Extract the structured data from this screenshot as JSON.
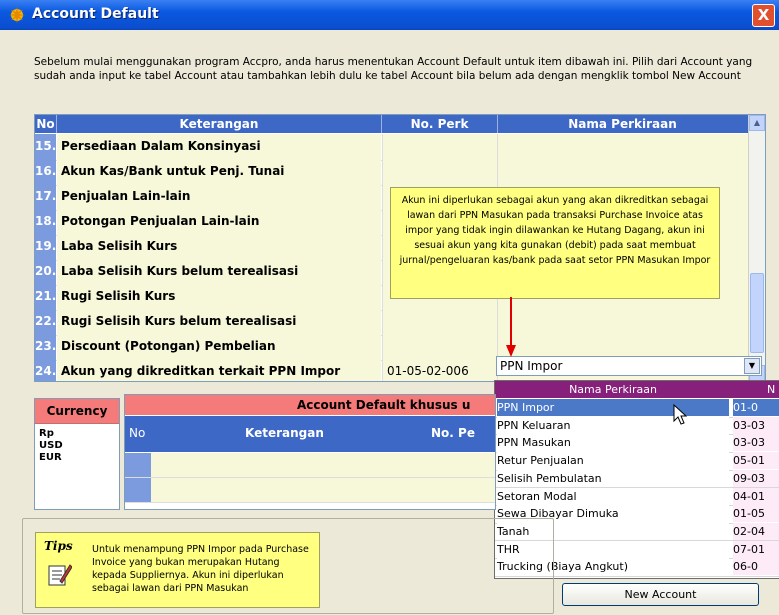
{
  "window": {
    "title": "Account Default",
    "close_label": "X"
  },
  "intro_text": "Sebelum mulai menggunakan program Accpro, anda harus menentukan  Account  Default untuk item dibawah ini. Pilih dari Account yang sudah anda input ke tabel Account atau tambahkan lebih dulu ke tabel Account bila belum ada dengan mengklik tombol New Account",
  "main_grid": {
    "headers": {
      "no": "No",
      "keterangan": "Keterangan",
      "no_perk": "No. Perk",
      "nama_perkiraan": "Nama Perkiraan"
    },
    "rows": [
      {
        "no": "15.",
        "keterangan": "Persediaan Dalam Konsinyasi",
        "no_perk": "",
        "nama": ""
      },
      {
        "no": "16.",
        "keterangan": "Akun Kas/Bank untuk Penj. Tunai",
        "no_perk": "",
        "nama": ""
      },
      {
        "no": "17.",
        "keterangan": "Penjualan Lain-lain",
        "no_perk": "",
        "nama": ""
      },
      {
        "no": "18.",
        "keterangan": "Potongan Penjualan Lain-lain",
        "no_perk": "",
        "nama": ""
      },
      {
        "no": "19.",
        "keterangan": "Laba Selisih Kurs",
        "no_perk": "",
        "nama": ""
      },
      {
        "no": "20.",
        "keterangan": "Laba Selisih Kurs belum terealisasi",
        "no_perk": "",
        "nama": ""
      },
      {
        "no": "21.",
        "keterangan": "Rugi Selisih Kurs",
        "no_perk": "",
        "nama": ""
      },
      {
        "no": "22.",
        "keterangan": "Rugi Selisih Kurs belum terealisasi",
        "no_perk": "",
        "nama": ""
      },
      {
        "no": "23.",
        "keterangan": "Discount (Potongan) Pembelian",
        "no_perk": "",
        "nama": ""
      },
      {
        "no": "24.",
        "keterangan": "Akun yang dikreditkan terkait PPN Impor",
        "no_perk": "01-05-02-006",
        "nama": ""
      }
    ],
    "combo_value": "PPN Impor"
  },
  "tooltip": "Akun ini diperlukan sebagai akun yang akan dikreditkan sebagai lawan dari PPN Masukan pada transaksi Purchase Invoice atas impor yang tidak ingin dilawankan ke Hutang Dagang, akun ini sesuai akun yang kita gunakan (debit) pada saat membuat jurnal/pengeluaran kas/bank pada saat setor PPN Masukan Impor",
  "dropdown": {
    "headers": {
      "nama": "Nama Perkiraan",
      "no": "N"
    },
    "items": [
      {
        "nama": "PPN Impor",
        "no": "01-0",
        "selected": true
      },
      {
        "nama": "PPN Keluaran",
        "no": "03-03"
      },
      {
        "nama": "PPN Masukan",
        "no": "03-03"
      },
      {
        "nama": "Retur Penjualan",
        "no": "05-01"
      },
      {
        "nama": "Selisih Pembulatan",
        "no": "09-03"
      },
      {
        "nama": "Setoran Modal",
        "no": "04-01"
      },
      {
        "nama": "Sewa Dibayar Dimuka",
        "no": "01-05"
      },
      {
        "nama": "Tanah",
        "no": "02-04"
      },
      {
        "nama": "THR",
        "no": "07-01"
      },
      {
        "nama": "Trucking (Biaya Angkut)",
        "no": "06-0"
      }
    ]
  },
  "currency": {
    "header": "Currency",
    "items": [
      "Rp",
      "USD",
      "EUR"
    ]
  },
  "currency_grid": {
    "title": "Account Default khusus u",
    "headers": {
      "no": "No",
      "keterangan": "Keterangan",
      "no_perk": "No. Pe"
    }
  },
  "tips": {
    "title": "Tips",
    "text": "Untuk menampung PPN Impor pada Purchase Invoice yang bukan merupakan Hutang kepada Suppliernya. Akun ini diperlukan sebagai lawan dari PPN Masukan"
  },
  "new_account_button": "New Account",
  "colors": {
    "grid_header": "#3d68c5",
    "row_number": "#7c9ade",
    "row_bg": "#f7f7d9",
    "tooltip": "#ffff80",
    "dropdown_header": "#86207b",
    "selection": "#4b79c8",
    "currency_header": "#f57a7a"
  }
}
